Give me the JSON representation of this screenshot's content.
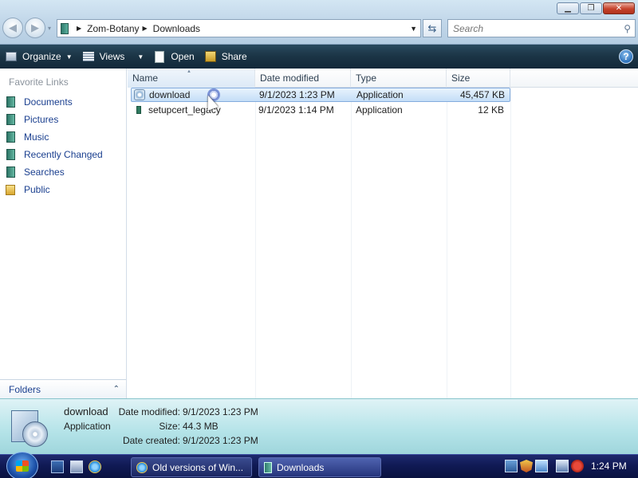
{
  "window": {
    "minimize_glyph": "▁",
    "maximize_glyph": "❐",
    "close_glyph": "✕"
  },
  "navigation": {
    "back_glyph": "◀",
    "forward_glyph": "▶",
    "recent_glyph": "▾"
  },
  "address": {
    "crumbs": [
      "Zom-Botany",
      "Downloads"
    ],
    "separator_glyph": "▶",
    "dropdown_glyph": "▼",
    "refresh_glyph": "⇆"
  },
  "search": {
    "placeholder": "Search",
    "icon": "search-icon"
  },
  "toolbar": {
    "organize": "Organize",
    "views": "Views",
    "open": "Open",
    "share": "Share",
    "dropdown_glyph": "▼",
    "help_glyph": "?"
  },
  "sidebar": {
    "title": "Favorite Links",
    "items": [
      {
        "label": "Documents",
        "icon": "documents-icon"
      },
      {
        "label": "Pictures",
        "icon": "pictures-icon"
      },
      {
        "label": "Music",
        "icon": "music-icon"
      },
      {
        "label": "Recently Changed",
        "icon": "recently-changed-icon"
      },
      {
        "label": "Searches",
        "icon": "searches-icon"
      },
      {
        "label": "Public",
        "icon": "public-folder-icon"
      }
    ],
    "folders_label": "Folders",
    "folders_chevron": "⌃"
  },
  "columns": {
    "name": "Name",
    "date_modified": "Date modified",
    "type": "Type",
    "size": "Size",
    "sort_glyph": "▲"
  },
  "files": [
    {
      "name": "download",
      "date": "9/1/2023 1:23 PM",
      "type": "Application",
      "size": "45,457 KB",
      "selected": true
    },
    {
      "name": "setupcert_legacy",
      "date": "9/1/2023 1:14 PM",
      "type": "Application",
      "size": "12 KB",
      "selected": false
    }
  ],
  "details": {
    "name": "download",
    "type": "Application",
    "date_modified_label": "Date modified:",
    "date_modified": "9/1/2023 1:23 PM",
    "size_label": "Size:",
    "size": "44.3 MB",
    "date_created_label": "Date created:",
    "date_created": "9/1/2023 1:23 PM"
  },
  "taskbar": {
    "tasks": [
      {
        "label": "Old versions of Win...",
        "icon": "internet-explorer-icon"
      },
      {
        "label": "Downloads",
        "icon": "folder-icon"
      }
    ],
    "clock": "1:24 PM"
  },
  "colors": {
    "commandbar": "#1b3445",
    "link": "#1a3f8f",
    "details_pane": "#b4e3e8",
    "taskbar": "#101a55"
  }
}
